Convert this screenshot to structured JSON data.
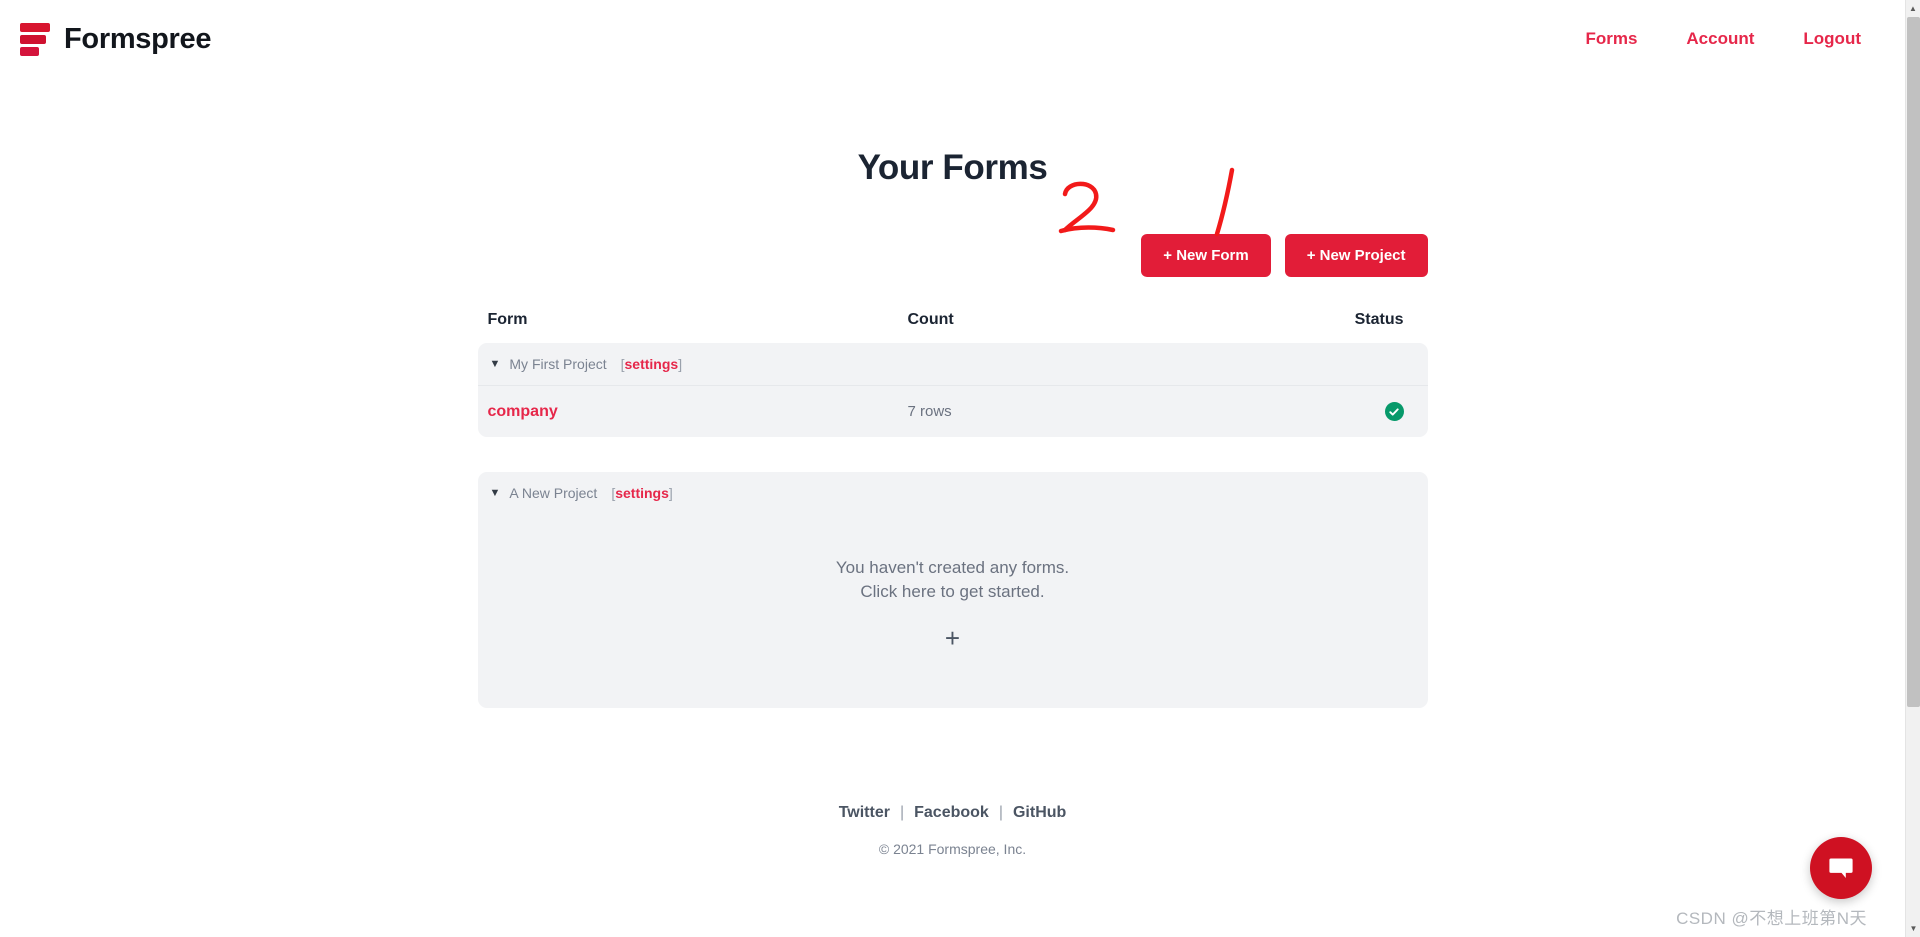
{
  "header": {
    "brand_name": "Formspree",
    "logo_icon": "formspree-bars-icon",
    "nav": [
      {
        "label": "Forms",
        "name": "nav-link-forms"
      },
      {
        "label": "Account",
        "name": "nav-link-account"
      },
      {
        "label": "Logout",
        "name": "nav-link-logout"
      }
    ]
  },
  "main": {
    "page_title": "Your Forms",
    "buttons": {
      "new_form": "+ New Form",
      "new_project": "+ New Project"
    },
    "annotations": [
      {
        "text": "2",
        "over": "new-form-button"
      },
      {
        "text": "1",
        "over": "new-project-button"
      }
    ],
    "table_headers": {
      "form": "Form",
      "count": "Count",
      "status": "Status"
    },
    "projects": [
      {
        "name": "My First Project",
        "settings_label": "settings",
        "caret": "▼",
        "forms": [
          {
            "name": "company",
            "count": "7 rows",
            "status_icon": "check-circle-icon",
            "status_color": "#07996a"
          }
        ],
        "empty": null
      },
      {
        "name": "A New Project",
        "settings_label": "settings",
        "caret": "▼",
        "forms": [],
        "empty": {
          "line1": "You haven't created any forms.",
          "line2": "Click here to get started.",
          "plus_label": "+"
        }
      }
    ]
  },
  "footer": {
    "links": [
      {
        "label": "Twitter",
        "name": "footer-link-twitter"
      },
      {
        "label": "Facebook",
        "name": "footer-link-facebook"
      },
      {
        "label": "GitHub",
        "name": "footer-link-github"
      }
    ],
    "separator": "|",
    "copyright": "© 2021 Formspree, Inc."
  },
  "chat": {
    "icon": "chat-bubble-icon",
    "color": "#cf1122"
  },
  "watermark": "CSDN @不想上班第N天",
  "colors": {
    "brand_red": "#e21d38",
    "nav_red": "#e6274a",
    "card_gray": "#f2f3f5",
    "title_navy": "#1b2432",
    "status_green": "#07996a"
  }
}
